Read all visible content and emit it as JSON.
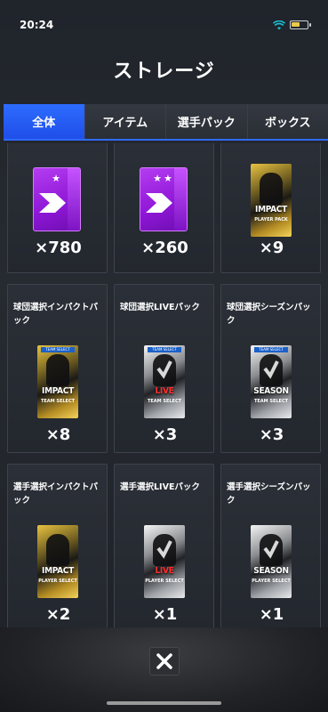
{
  "status_bar": {
    "time": "20:24",
    "battery_level": 0.55
  },
  "page_title": "ストレージ",
  "tabs": [
    {
      "label": "全体",
      "active": true
    },
    {
      "label": "アイテム",
      "active": false
    },
    {
      "label": "選手パック",
      "active": false
    },
    {
      "label": "ボックス",
      "active": false
    }
  ],
  "items": [
    {
      "title": "",
      "kind": "ticket",
      "stars": "★",
      "count": "×780"
    },
    {
      "title": "",
      "kind": "ticket",
      "stars": "★★",
      "count": "×260"
    },
    {
      "title": "",
      "kind": "pack",
      "finish": "gold",
      "name": "IMPACT",
      "sub": "PLAYER PACK",
      "count": "×9"
    },
    {
      "title": "球団選択インパクトパック",
      "kind": "pack",
      "finish": "gold",
      "header": "TEAM SELECT",
      "name": "IMPACT",
      "sub": "TEAM SELECT",
      "count": "×8"
    },
    {
      "title": "球団選択LIVEパック",
      "kind": "pack",
      "finish": "silver",
      "header": "TEAM SELECT",
      "name": "LIVE",
      "sub": "TEAM SELECT",
      "count": "×3"
    },
    {
      "title": "球団選択シーズンパック",
      "kind": "pack",
      "finish": "silver",
      "header": "TEAM SELECT",
      "name": "SEASON",
      "sub": "TEAM SELECT",
      "count": "×3"
    },
    {
      "title": "選手選択インパクトパック",
      "kind": "pack",
      "finish": "gold",
      "name": "IMPACT",
      "sub": "PLAYER SELECT",
      "count": "×2"
    },
    {
      "title": "選手選択LIVEパック",
      "kind": "pack",
      "finish": "silver",
      "name": "LIVE",
      "sub": "PLAYER SELECT",
      "count": "×1"
    },
    {
      "title": "選手選択シーズンパック",
      "kind": "pack",
      "finish": "silver",
      "name": "SEASON",
      "sub": "PLAYER SELECT",
      "count": "×1"
    }
  ],
  "close_icon": "close-icon",
  "colors": {
    "accent": "#2d6cff",
    "ticket": "#9b22e0",
    "live_red": "#ff2f2f"
  }
}
